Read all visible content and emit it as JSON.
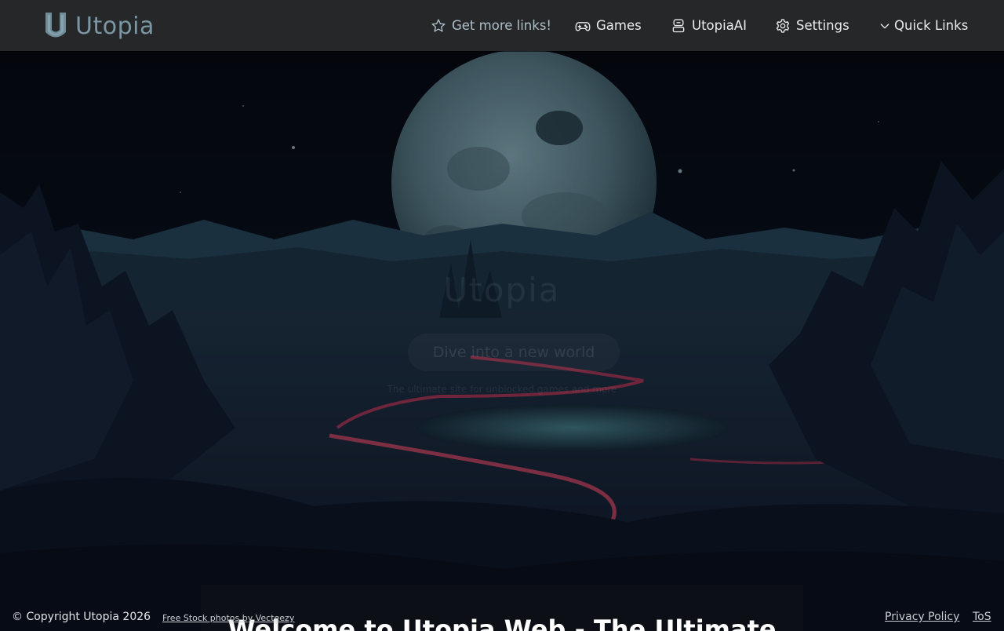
{
  "header": {
    "brand": "Utopia",
    "nav": {
      "more_links": "Get more links!",
      "games": "Games",
      "ai": "UtopiaAI",
      "settings": "Settings",
      "quick_links": "Quick Links"
    }
  },
  "hero": {
    "faded_title": "Utopia",
    "faded_tagline": "Dive into a new world",
    "faded_subtitle": "The ultimate site for unblocked games and more",
    "welcome": "Welcome to Utopia Web - The Ultimate"
  },
  "footer": {
    "copyright": "© Copyright Utopia 2026",
    "credit": "Free Stock photos by Vecteezy",
    "privacy": "Privacy Policy",
    "tos": "ToS"
  },
  "icons": {
    "logo": "utopia-shield-logo",
    "more_links": "star-icon",
    "games": "gamepad-icon",
    "ai": "robot-icon",
    "settings": "gear-icon",
    "quick_links": "chevron-down-icon"
  },
  "colors": {
    "header_bg": "#262729",
    "brand": "#7b97a3",
    "accent_lava": "#c8365a",
    "sky": "#070a12"
  }
}
